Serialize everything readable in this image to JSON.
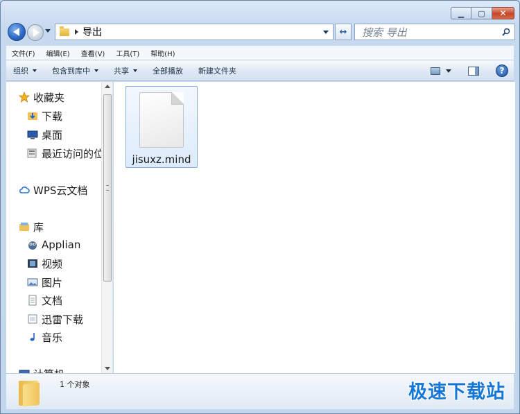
{
  "window": {
    "caption": {
      "minimize_glyph": "▁",
      "maximize_glyph": "▢",
      "close_glyph": "✕"
    }
  },
  "address_bar": {
    "current_folder": "导出"
  },
  "search": {
    "placeholder": "搜索 导出"
  },
  "menu": {
    "items": [
      "文件(F)",
      "编辑(E)",
      "查看(V)",
      "工具(T)",
      "帮助(H)"
    ]
  },
  "command_bar": {
    "organize": "组织",
    "include_in_library": "包含到库中",
    "share": "共享",
    "play_all": "全部播放",
    "new_folder": "新建文件夹",
    "help_glyph": "?"
  },
  "nav_pane": {
    "items": [
      {
        "label": "收藏夹",
        "icon": "star-icon"
      },
      {
        "label": "下载",
        "icon": "download-folder-icon"
      },
      {
        "label": "桌面",
        "icon": "desktop-icon"
      },
      {
        "label": "最近访问的位",
        "icon": "recent-places-icon"
      },
      {
        "label": "WPS云文档",
        "icon": "cloud-icon"
      },
      {
        "label": "库",
        "icon": "library-icon"
      },
      {
        "label": "Applian",
        "icon": "owl-icon"
      },
      {
        "label": "视频",
        "icon": "video-icon"
      },
      {
        "label": "图片",
        "icon": "picture-icon"
      },
      {
        "label": "文档",
        "icon": "document-icon"
      },
      {
        "label": "迅雷下载",
        "icon": "thunder-download-icon"
      },
      {
        "label": "音乐",
        "icon": "music-icon"
      },
      {
        "label": "计算机",
        "icon": "computer-icon"
      }
    ]
  },
  "files": [
    {
      "name": "jisuxz.mind",
      "icon": "generic-file-icon"
    }
  ],
  "status": {
    "item_count": "1 个对象"
  },
  "watermark": "极速下载站",
  "colors": {
    "accent": "#2b66c4",
    "selection_border": "#84acdd",
    "watermark": "#1677d6"
  }
}
